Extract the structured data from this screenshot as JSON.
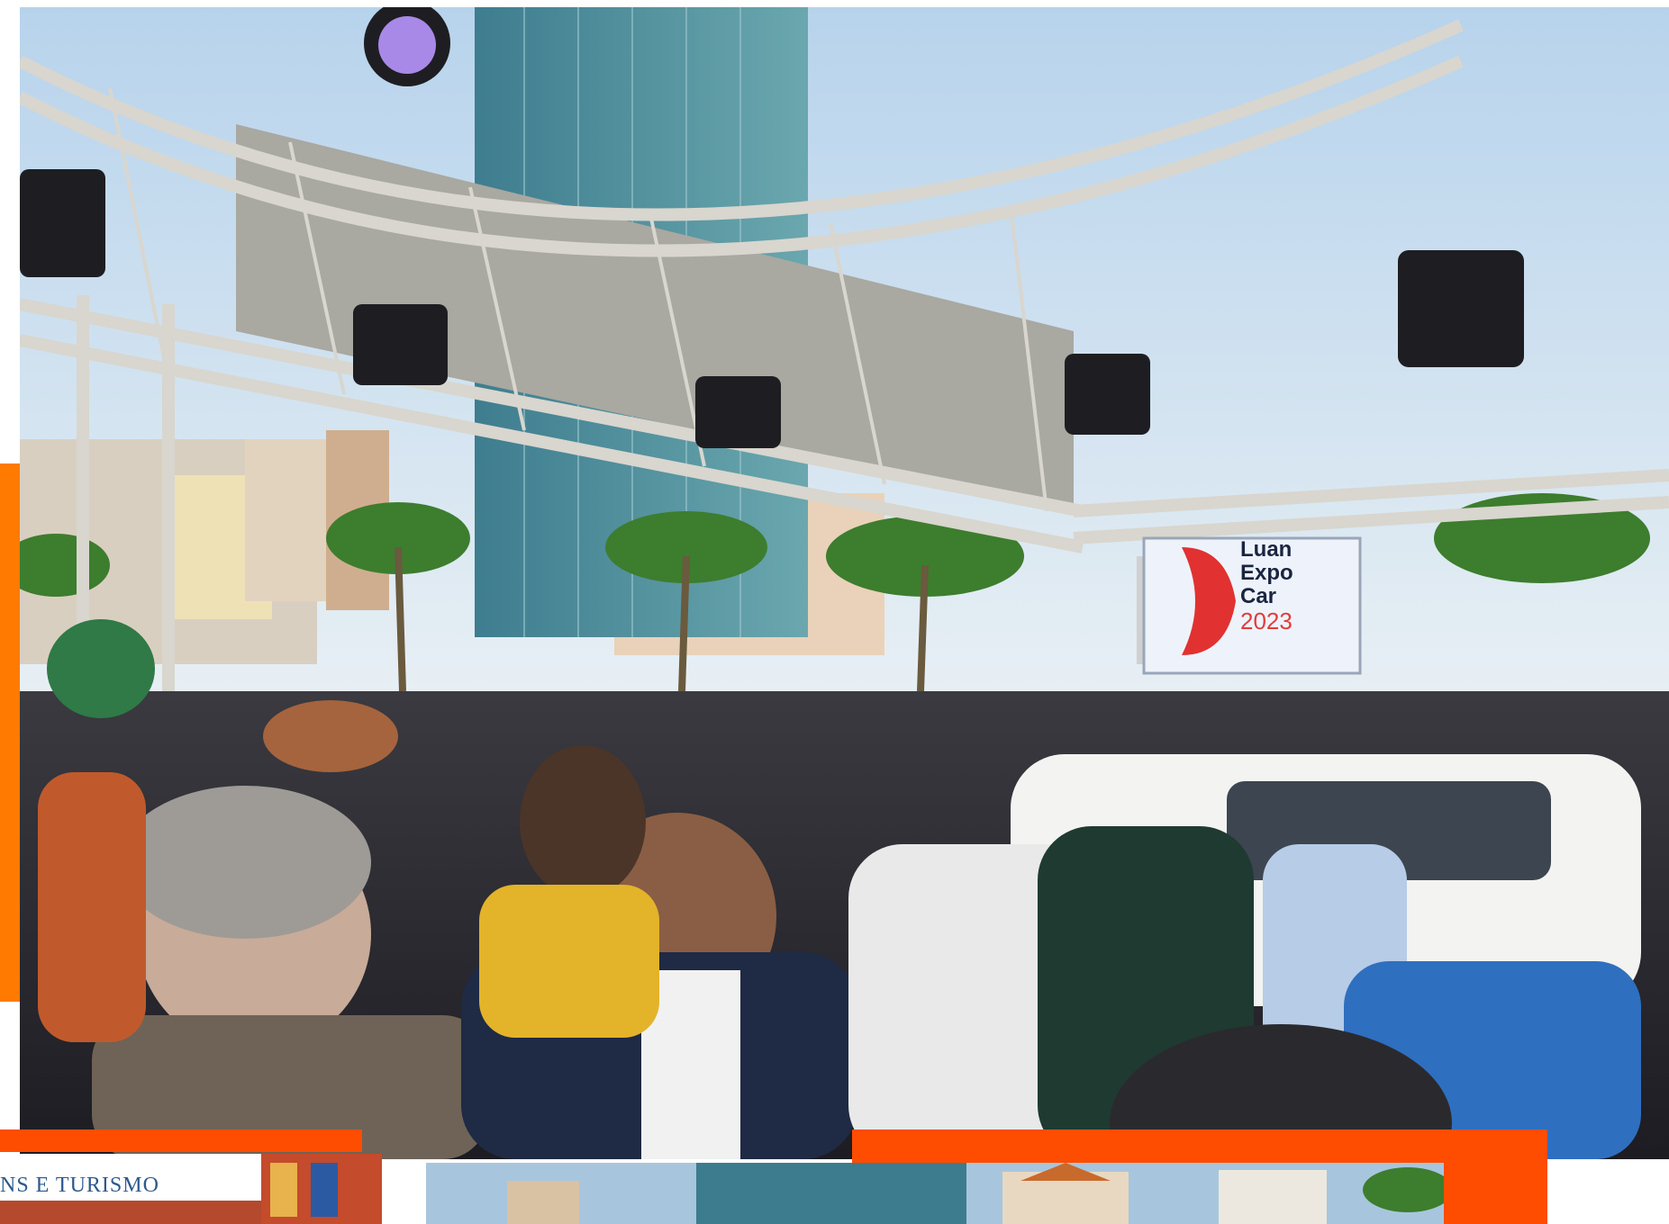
{
  "photo": {
    "sign": {
      "line1": "Luan",
      "line2": "Expo",
      "line3": "Car",
      "year": "2023"
    },
    "accent_color": "#ff7a00",
    "strip_color": "#ff4d00"
  },
  "thumbnails": {
    "first_banner": "NS E TURISMO"
  }
}
